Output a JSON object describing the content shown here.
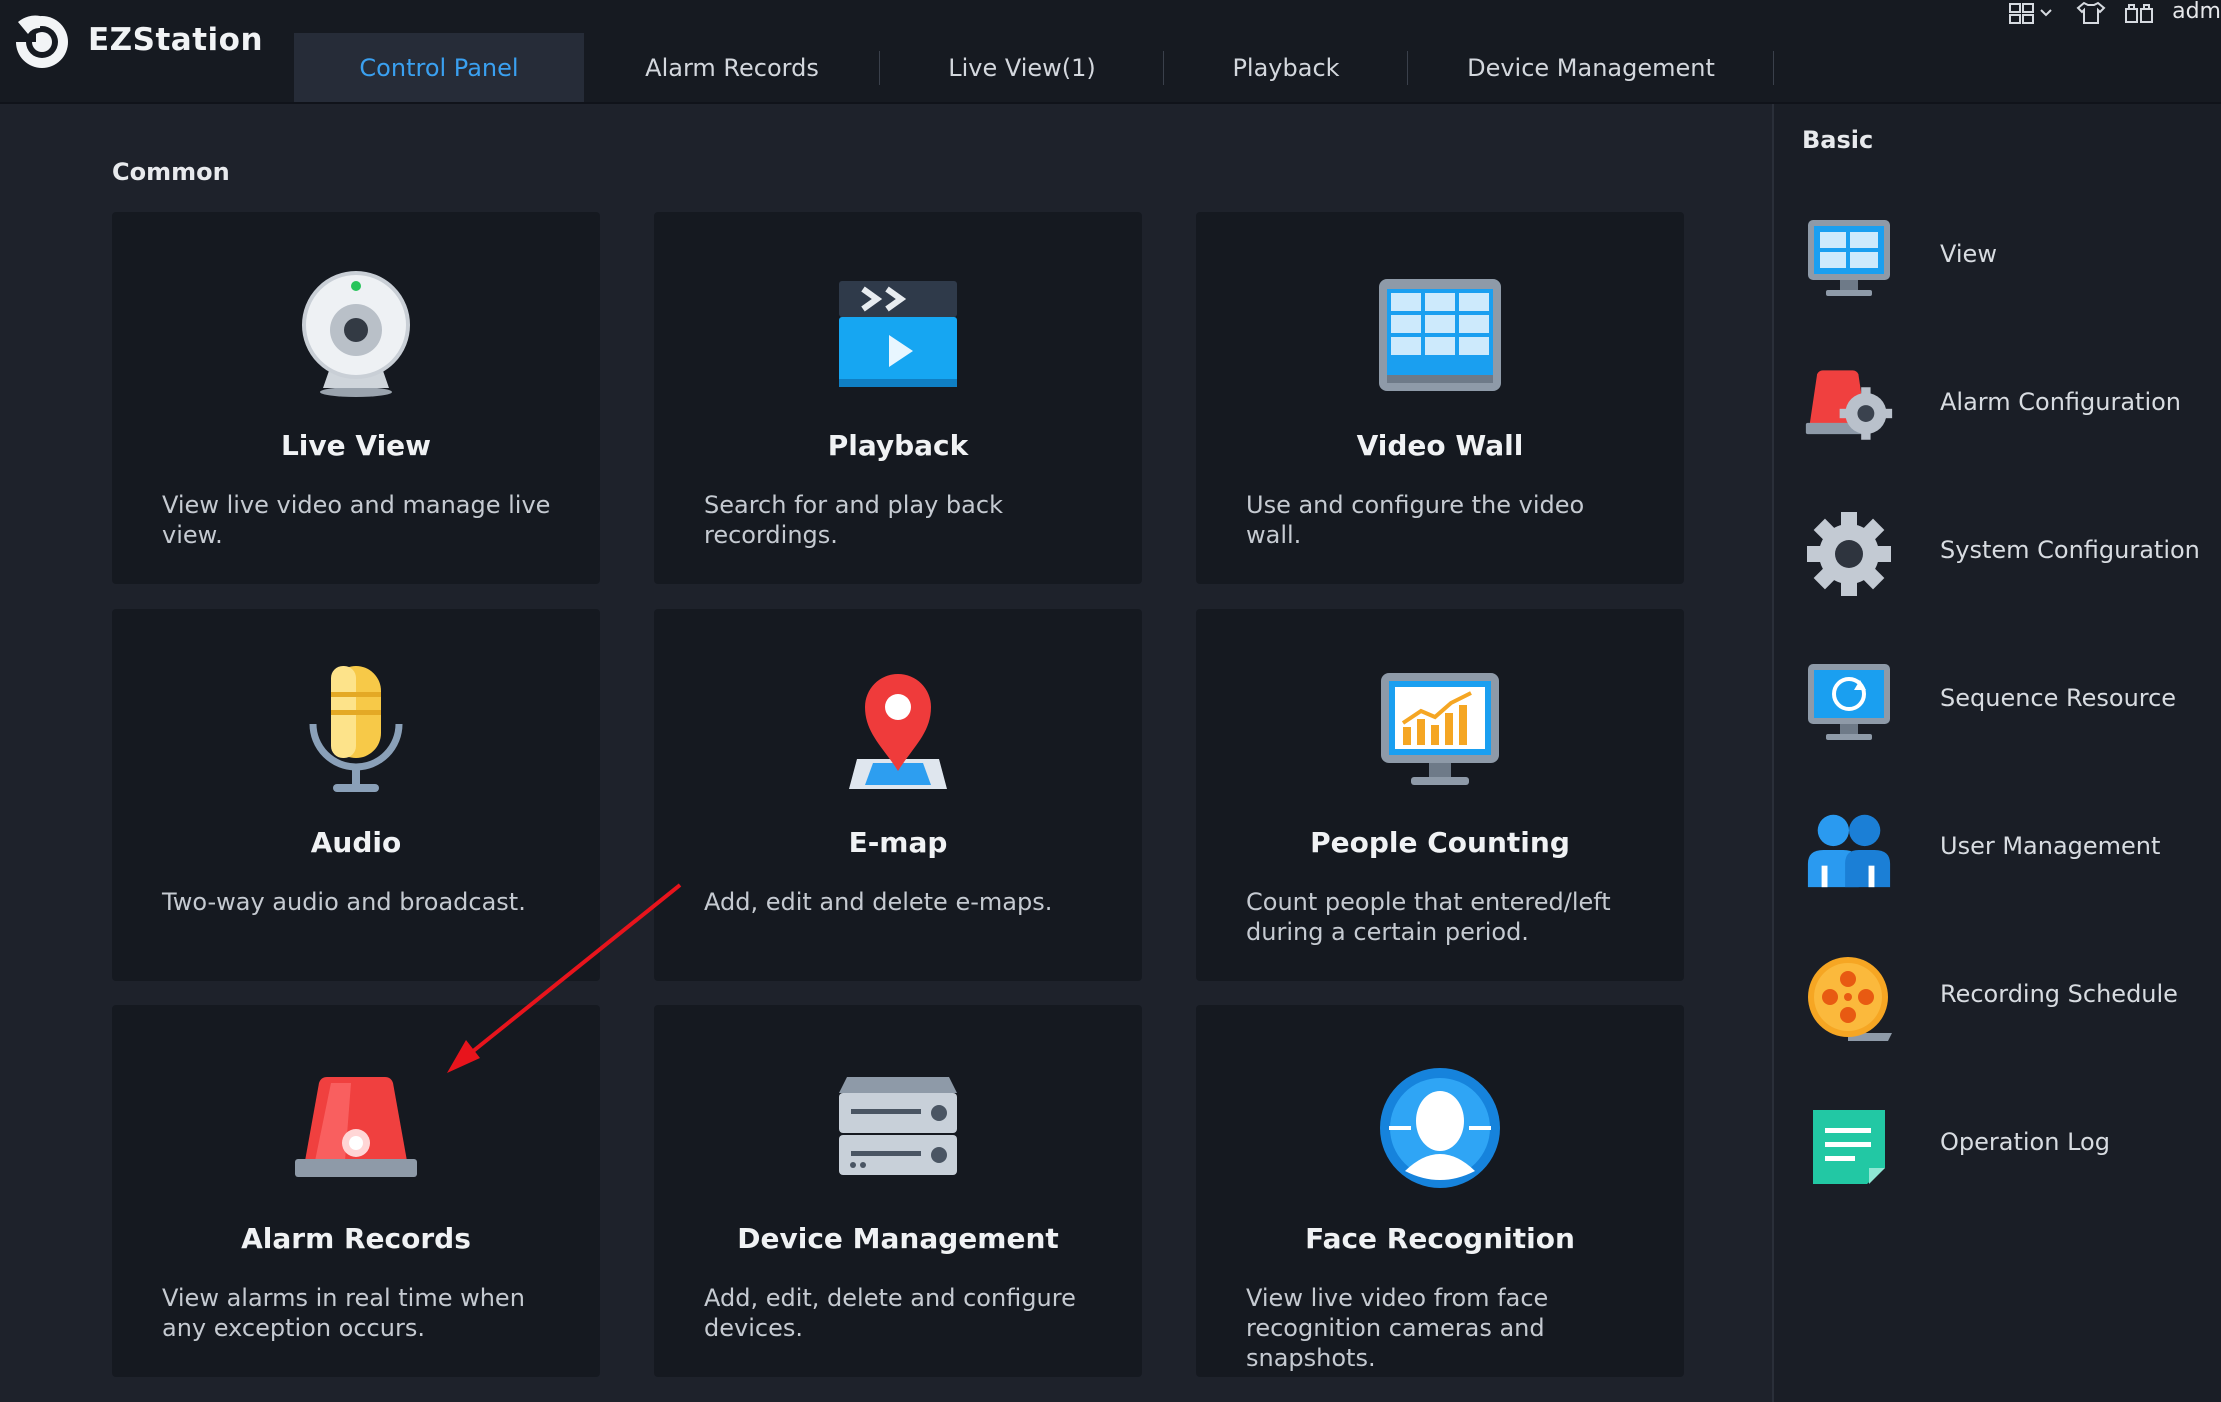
{
  "app": {
    "title": "EZStation",
    "user": "adm"
  },
  "nav": {
    "tabs": [
      {
        "label": "Control Panel",
        "active": true
      },
      {
        "label": "Alarm Records"
      },
      {
        "label": "Live View(1)"
      },
      {
        "label": "Playback"
      },
      {
        "label": "Device Management"
      }
    ]
  },
  "toolbar_icons": [
    "layout-grid-icon",
    "shirt-skin-icon",
    "lock-screen-icon"
  ],
  "main": {
    "section_title": "Common",
    "cards": [
      {
        "title": "Live View",
        "desc": "View live video and manage live view.",
        "icon": "webcam-icon"
      },
      {
        "title": "Playback",
        "desc": "Search for and play back recordings.",
        "icon": "clapper-play-icon"
      },
      {
        "title": "Video Wall",
        "desc": "Use and configure the video wall.",
        "icon": "video-wall-icon"
      },
      {
        "title": "Audio",
        "desc": "Two-way audio and broadcast.",
        "icon": "microphone-icon"
      },
      {
        "title": "E-map",
        "desc": "Add, edit and delete e-maps.",
        "icon": "map-pin-icon"
      },
      {
        "title": "People Counting",
        "desc": "Count people that entered/left during a certain period.",
        "icon": "chart-monitor-icon"
      },
      {
        "title": "Alarm Records",
        "desc": "View alarms in real time when any exception occurs.",
        "icon": "alarm-light-icon"
      },
      {
        "title": "Device Management",
        "desc": "Add, edit, delete and configure devices.",
        "icon": "nvr-device-icon"
      },
      {
        "title": "Face Recognition",
        "desc": "View live video from face recognition cameras and snapshots.",
        "icon": "face-icon"
      }
    ]
  },
  "right_panel": {
    "title": "Basic",
    "items": [
      {
        "label": "View",
        "icon": "monitor-view-icon"
      },
      {
        "label": "Alarm Configuration",
        "icon": "alarm-gear-icon"
      },
      {
        "label": "System Configuration",
        "icon": "gear-icon"
      },
      {
        "label": "Sequence Resource",
        "icon": "monitor-refresh-icon"
      },
      {
        "label": "User Management",
        "icon": "users-icon"
      },
      {
        "label": "Recording Schedule",
        "icon": "film-reel-icon"
      },
      {
        "label": "Operation Log",
        "icon": "log-note-icon"
      }
    ]
  },
  "colors": {
    "accent": "#3aa0f0",
    "background": "#1e222b",
    "card": "#151920",
    "annotation_arrow": "#e8141c"
  }
}
